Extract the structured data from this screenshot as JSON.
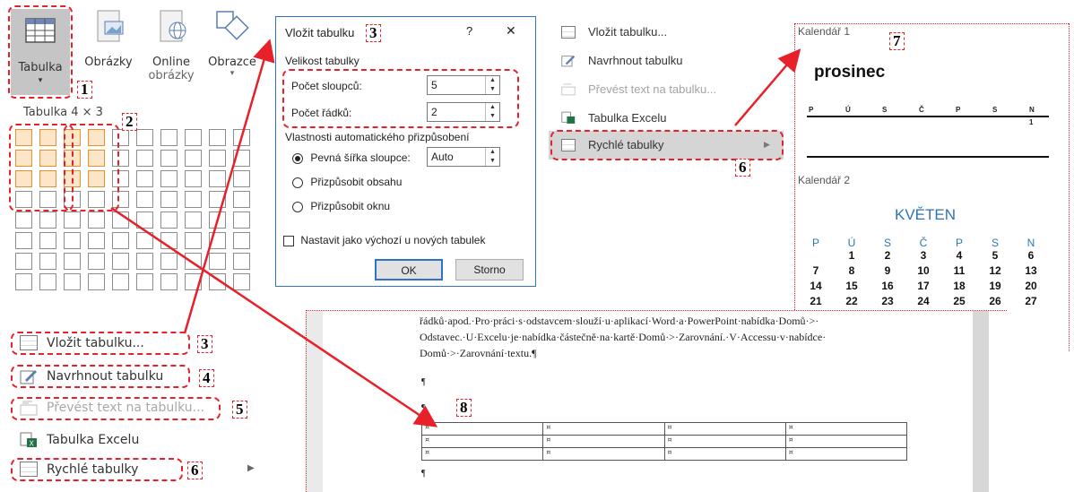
{
  "panel1": {
    "ribbon": {
      "table_label": "Tabulka",
      "pictures_label": "Obrázky",
      "online_label": "Online",
      "online_label2": "obrázky",
      "shapes_label": "Obrazce"
    },
    "grid_caption": "Tabulka 4 × 3",
    "menu": {
      "insert_table": "Vložit tabulku...",
      "draw_table": "Navrhnout tabulku",
      "convert_text": "Převést text na tabulku...",
      "excel_table": "Tabulka Excelu",
      "quick_tables": "Rychlé tabulky"
    }
  },
  "dialog": {
    "title": "Vložit tabulku",
    "help": "?",
    "close": "✕",
    "size_section": "Velikost tabulky",
    "columns_label": "Počet sloupců:",
    "columns_value": "5",
    "rows_label": "Počet řádků:",
    "rows_value": "2",
    "autofit_section": "Vlastnosti automatického přizpůsobení",
    "fixed_width_label": "Pevná šířka sloupce:",
    "fixed_width_value": "Auto",
    "autofit_contents": "Přizpůsobit obsahu",
    "autofit_window": "Přizpůsobit oknu",
    "default_checkbox": "Nastavit jako výchozí u nových tabulek",
    "ok": "OK",
    "cancel": "Storno"
  },
  "menu3": {
    "insert_table": "Vložit tabulku...",
    "draw_table": "Navrhnout tabulku",
    "convert_text": "Převést text na tabulku...",
    "excel_table": "Tabulka Excelu",
    "quick_tables": "Rychlé tabulky"
  },
  "calendars": {
    "cal1_title": "Kalendář 1",
    "cal1_month": "prosinec",
    "cal1_days": [
      "P",
      "Ú",
      "S",
      "Č",
      "P",
      "S",
      "N"
    ],
    "cal1_first": "1",
    "cal2_title": "Kalendář 2",
    "cal2_month": "KVĚTEN",
    "cal2_days": [
      "P",
      "Ú",
      "S",
      "Č",
      "P",
      "S",
      "N"
    ],
    "cal2_rows": [
      [
        "",
        "1",
        "2",
        "3",
        "4",
        "5",
        "6"
      ],
      [
        "7",
        "8",
        "9",
        "10",
        "11",
        "12",
        "13"
      ],
      [
        "14",
        "15",
        "16",
        "17",
        "18",
        "19",
        "20"
      ],
      [
        "21",
        "22",
        "23",
        "24",
        "25",
        "26",
        "27"
      ]
    ]
  },
  "document": {
    "line1": "řádků·apod.·Pro·práci·s·odstavcem·slouží·u·aplikací·Word·a·PowerPoint·nabídka·Domů·>·",
    "line2": "Odstavec.·U·Excelu·je·nabídka·částečně·na·kartě·Domů·>·Zarovnání.·V·Accessu·v·nabídce·",
    "line3": "Domů·>·Zarovnání·textu.¶",
    "pilcrow": "¶",
    "cell_mark": "¤"
  },
  "callouts": [
    "1",
    "2",
    "3",
    "3",
    "4",
    "5",
    "6",
    "6",
    "7",
    "8"
  ],
  "colors": {
    "accent_red": "#e8202a",
    "dialog_border": "#2f73c5",
    "calendar_blue": "#2e74b5",
    "grid_selected": "#e7902f"
  }
}
